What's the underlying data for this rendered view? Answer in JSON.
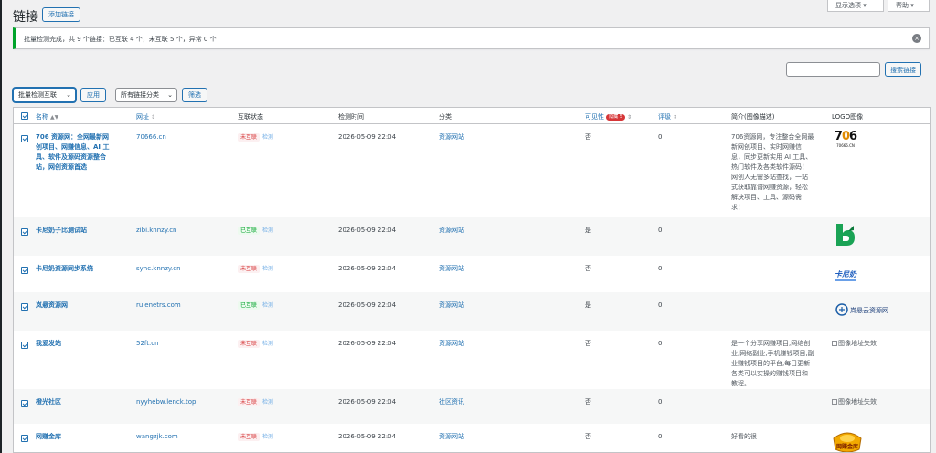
{
  "header": {
    "title": "链接",
    "add_link_label": "添加链接",
    "screen_options_label": "显示选项 ▾",
    "help_label": "帮助 ▾"
  },
  "notice": {
    "text": "批量检测完成，共 9 个链接：已互联 4 个，未互联 5 个，异常 0 个"
  },
  "search": {
    "value": "",
    "button_label": "搜索链接"
  },
  "bulk": {
    "action_selected": "批量检测互联",
    "apply_label": "应用",
    "category_selected": "所有链接分类",
    "filter_label": "筛选"
  },
  "table": {
    "columns": {
      "name": "名称",
      "url": "网址",
      "status": "互联状态",
      "time": "检测时间",
      "category": "分类",
      "visibility": "可见性",
      "visibility_badge": "隐藏 5",
      "rating": "评级",
      "desc": "简介(图像描述)",
      "logo": "LOGO图像"
    },
    "check_link_label": "检测",
    "rows": [
      {
        "name_lines": [
          "706 资源网：全网最新网",
          "创项目、网赚信息、AI 工",
          "具、软件及源码资源整合",
          "站，网创资源首选"
        ],
        "url": "70666.cn",
        "status": "未互联",
        "time": "2026-05-09 22:04",
        "category": "资源网站",
        "visible": "否",
        "rating": "0",
        "desc_lines": [
          "706资源网，专注整合全网最",
          "新网创项目、实时网赚信",
          "息，同步更新实用 AI 工具、",
          "热门软件及各类软件源码！",
          "网创人无需多站查找，一站",
          "式获取靠谱网赚资源，轻松",
          "解决项目、工具、源码需",
          "求！"
        ],
        "logo": "706"
      },
      {
        "name_lines": [
          "卡尼奶子比测试站"
        ],
        "url": "zibi.knnzy.cn",
        "status": "已互联",
        "time": "2026-05-09 22:04",
        "category": "资源网站",
        "visible": "是",
        "rating": "0",
        "desc_lines": [],
        "logo": "b"
      },
      {
        "name_lines": [
          "卡尼奶资源同步系统"
        ],
        "url": "sync.knnzy.cn",
        "status": "未互联",
        "time": "2026-05-09 22:04",
        "category": "资源网站",
        "visible": "否",
        "rating": "0",
        "desc_lines": [],
        "logo": "kaniz"
      },
      {
        "name_lines": [
          "岚悬资源网"
        ],
        "url": "rulenetrs.com",
        "status": "已互联",
        "time": "2026-05-09 22:04",
        "category": "资源网站",
        "visible": "是",
        "rating": "0",
        "desc_lines": [],
        "logo": "lanchao"
      },
      {
        "name_lines": [
          "我爱发站"
        ],
        "url": "52ft.cn",
        "status": "未互联",
        "time": "2026-05-09 22:04",
        "category": "资源网站",
        "visible": "否",
        "rating": "0",
        "desc_lines": [
          "是一个分享网赚项目,网络创",
          "业,网络副业,手机赚钱项目,副",
          "业赚钱项目的平台,每日更新",
          "各类可以实操的赚钱项目和",
          "教程。"
        ],
        "logo": "broken",
        "logo_alt": "图像地址失效"
      },
      {
        "name_lines": [
          "橙光社区"
        ],
        "url": "nyyhebw.lenck.top",
        "status": "未互联",
        "time": "2026-05-09 22:04",
        "category": "社区资讯",
        "visible": "否",
        "rating": "0",
        "desc_lines": [],
        "logo": "broken",
        "logo_alt": "图像地址失效"
      },
      {
        "name_lines": [
          "网赚金库"
        ],
        "url": "wangzjk.com",
        "status": "未互联",
        "time": "2026-05-09 22:04",
        "category": "资源网站",
        "visible": "否",
        "rating": "0",
        "desc_lines": [
          "好看的很"
        ],
        "logo": "gold"
      }
    ]
  },
  "logos": {
    "706_big": "706",
    "706_small": "70666.CN",
    "kaniz_text": "卡尼奶",
    "lanchao_text": "岚悬云资源网",
    "gold_text": "网赚金库"
  },
  "colors": {
    "accent": "#2271b1",
    "success": "#00a32a",
    "danger": "#d63638",
    "background": "#f0f0f1"
  }
}
